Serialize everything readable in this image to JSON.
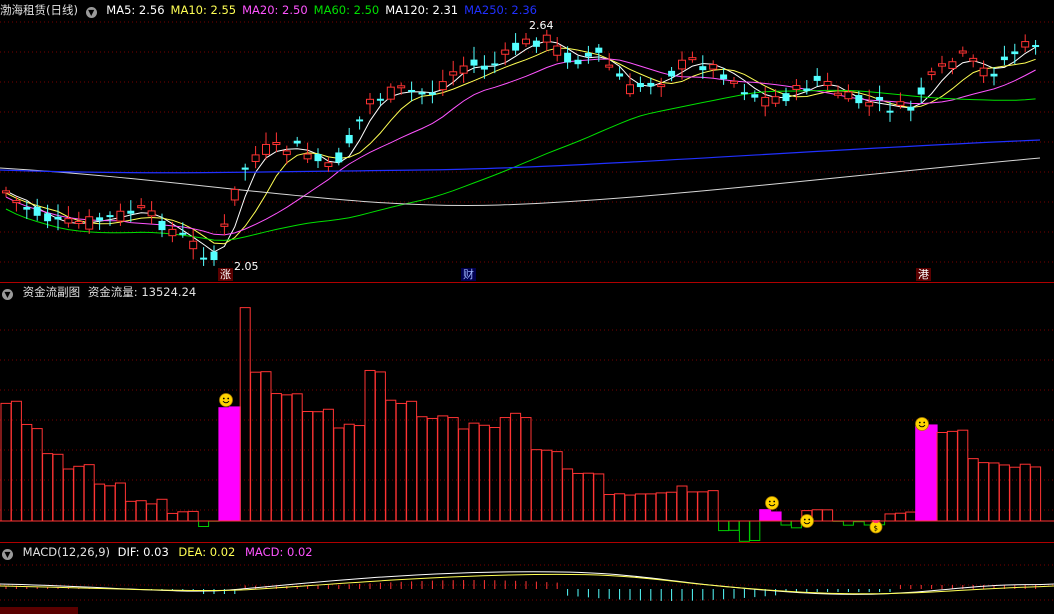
{
  "colors": {
    "up": "#ff3333",
    "down": "#54ffff",
    "ma5": "#ffffff",
    "ma10": "#ffff54",
    "ma20": "#ff54ff",
    "ma60": "#00e000",
    "ma120": "#ffffff",
    "ma250": "#2030ff",
    "grid": "#7a0000",
    "magenta": "#ff00ff",
    "green": "#00cc00",
    "dif": "#ffffff",
    "dea": "#ffff54"
  },
  "price_panel": {
    "stock_title": "渤海租赁(日线)",
    "toggle_icon": "chevron-down-icon",
    "ma_labels": [
      {
        "key": "ma5",
        "label": "MA5: 2.56"
      },
      {
        "key": "ma10",
        "label": "MA10: 2.55"
      },
      {
        "key": "ma20",
        "label": "MA20: 2.50"
      },
      {
        "key": "ma60",
        "label": "MA60: 2.50"
      },
      {
        "key": "ma120",
        "label": "MA120: 2.31"
      },
      {
        "key": "ma250",
        "label": "MA250: 2.36"
      }
    ],
    "high_label": "2.64",
    "low_label": "2.05",
    "event_markers": [
      "涨",
      "财",
      "港"
    ]
  },
  "flow_panel": {
    "title": "资金流副图",
    "value_label": "资金流量: 13524.24",
    "icons": [
      "smiley-icon",
      "smiley-icon",
      "smiley-icon",
      "money-bag-icon",
      "smiley-icon"
    ]
  },
  "macd_panel": {
    "title": "MACD(12,26,9)",
    "dif_label": "DIF: 0.03",
    "dea_label": "DEA: 0.02",
    "macd_label": "MACD: 0.02"
  }
}
